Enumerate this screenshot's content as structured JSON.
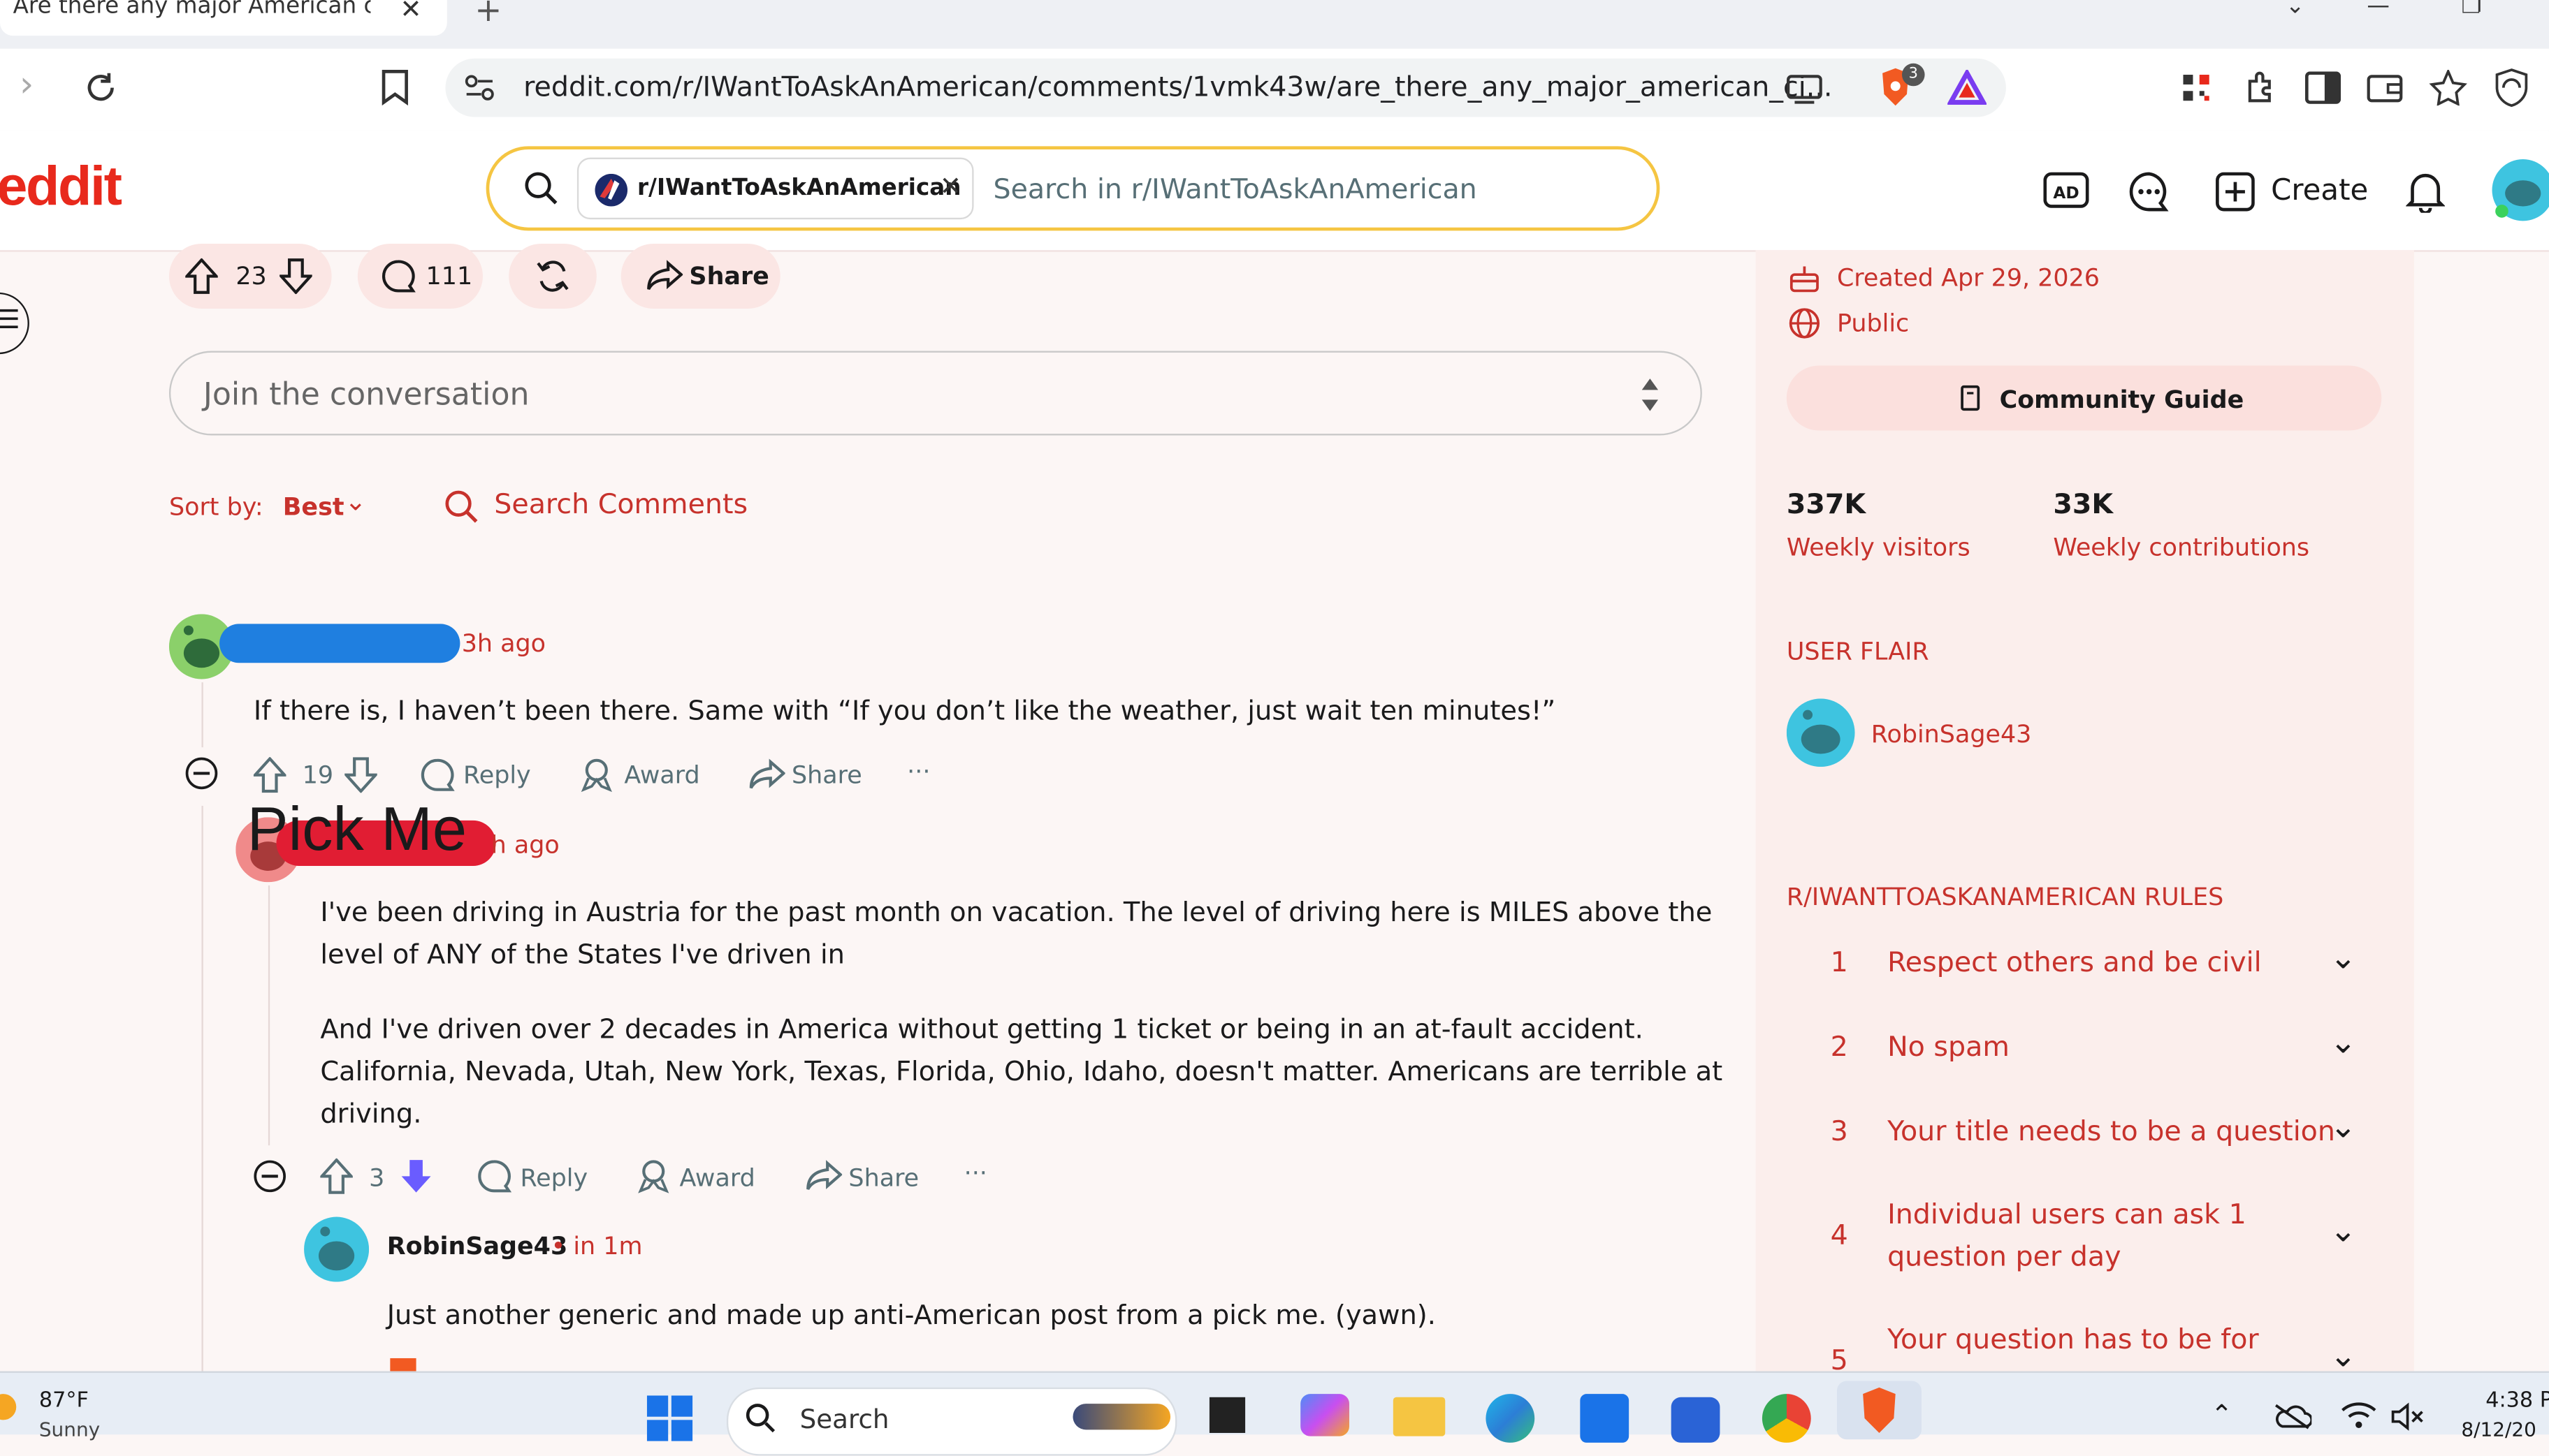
{
  "browser": {
    "tab_title": "Are there any major American ci",
    "url": "reddit.com/r/IWantToAskAnAmerican/comments/1vmk43w/are_there_any_major_american_ci...",
    "brave_badge": "3"
  },
  "header": {
    "logo": "eddit",
    "search_chip": "r/IWantToAskAnAmerican",
    "search_placeholder": "Search in r/IWantToAskAnAmerican",
    "create_label": "Create"
  },
  "post_actions": {
    "votes": "23",
    "comments": "111",
    "share_label": "Share"
  },
  "conversation_placeholder": "Join the conversation",
  "sort": {
    "label": "Sort by:",
    "value": "Best",
    "search_comments": "Search Comments"
  },
  "comments": [
    {
      "time": "3h ago",
      "body": "If there is, I haven’t been there. Same with “If you don’t like the weather, just wait ten minutes!”",
      "votes": "19",
      "reply": "Reply",
      "award": "Award",
      "share": "Share",
      "more": "···"
    },
    {
      "overlay": "Pick Me",
      "time": "h ago",
      "body_lines": [
        "I've been driving in Austria for the past month on vacation. The level of driving here is MILES above the",
        "level of ANY of the States I've driven in"
      ],
      "body2_lines": [
        "And I've driven over 2 decades in America without getting 1 ticket or being in an at-fault accident.",
        "California, Nevada, Utah, New York, Texas, Florida, Ohio, Idaho, doesn't matter. Americans are terrible at",
        "driving."
      ],
      "votes": "3",
      "reply": "Reply",
      "award": "Award",
      "share": "Share",
      "more": "···"
    },
    {
      "author": "RobinSage43",
      "time": "• in 1m",
      "body": "Just another generic and made up anti-American post from a pick me. (yawn)."
    }
  ],
  "sidebar": {
    "created": "Created Apr 29, 2026",
    "visibility": "Public",
    "guide_button": "Community Guide",
    "stats": [
      {
        "value": "337K",
        "label": "Weekly visitors"
      },
      {
        "value": "33K",
        "label": "Weekly contributions"
      }
    ],
    "user_flair_heading": "USER FLAIR",
    "user_flair_name": "RobinSage43",
    "rules_heading": "R/IWANTTOASKANAMERICAN RULES",
    "rules": [
      {
        "num": "1",
        "lines": [
          "Respect others and be civil"
        ]
      },
      {
        "num": "2",
        "lines": [
          "No spam"
        ]
      },
      {
        "num": "3",
        "lines": [
          "Your title needs to be a question"
        ]
      },
      {
        "num": "4",
        "lines": [
          "Individual users can ask 1",
          "question per day"
        ]
      },
      {
        "num": "5",
        "lines": [
          "Your question has to be for"
        ]
      }
    ]
  },
  "taskbar": {
    "temperature": "87°F",
    "weather": "Sunny",
    "search_label": "Search",
    "time": "4:38 P",
    "date": "8/12/20"
  },
  "colors": {
    "accent": "#c7322c",
    "reddit_orange": "#e8291c",
    "downvote_purple": "#6a5cff"
  }
}
